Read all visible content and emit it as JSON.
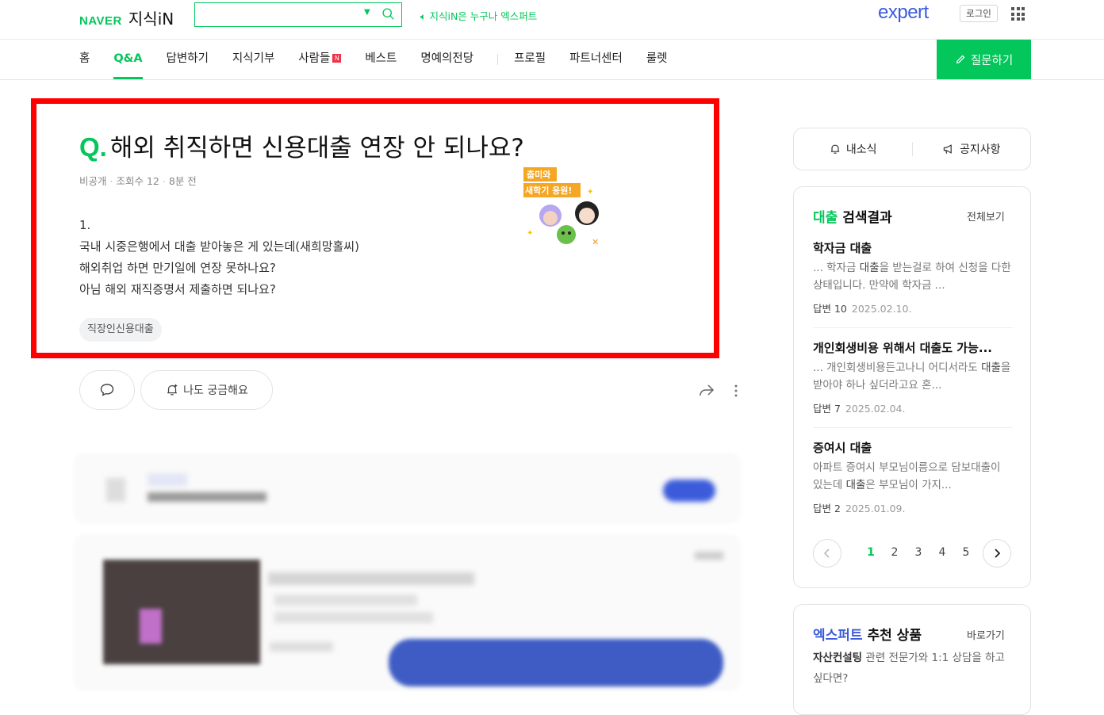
{
  "header": {
    "brand": "NAVER",
    "service": "지식iN",
    "search_value": "",
    "promo_text": "지식iN은 누구나 엑스퍼트",
    "expert_logo": "expert",
    "login_label": "로그인"
  },
  "nav": {
    "items": [
      {
        "label": "홈"
      },
      {
        "label": "Q&A"
      },
      {
        "label": "답변하기"
      },
      {
        "label": "지식기부"
      },
      {
        "label": "사람들"
      },
      {
        "label": "베스트"
      },
      {
        "label": "명예의전당"
      },
      {
        "label": "프로필"
      },
      {
        "label": "파트너센터"
      },
      {
        "label": "룰렛"
      }
    ],
    "new_badge": "N",
    "ask_label": "질문하기"
  },
  "question": {
    "prefix": "Q.",
    "title": "해외 취직하면 신용대출 연장 안 되나요?",
    "author": "비공개",
    "views": "조회수 12",
    "time": "8분 전",
    "body": [
      "1.",
      "국내 시중은행에서 대출 받아놓은 게 있는데(새희망홀씨)",
      "해외취업 하면 만기일에 연장 못하나요?",
      "아님 해외 재직증명서 제출하면 되나요?"
    ],
    "tag": "직장인신용대출",
    "sticker_line1": "춥미와",
    "sticker_line2": "새학기 응원!"
  },
  "actions": {
    "curious_label": "나도 궁금해요"
  },
  "side": {
    "news_label": "내소식",
    "notice_label": "공지사항",
    "result_keyword": "대출",
    "result_title": "검색결과",
    "result_all": "전체보기",
    "results": [
      {
        "title": "학자금 대출",
        "desc_pre": "... 학자금 ",
        "desc_hl": "대출",
        "desc_post": "을 받는걸로 하여 신청을 다한 상태입니다. 만약에 학자금 ...",
        "answers": "답변 10",
        "date": "2025.02.10."
      },
      {
        "title": "개인회생비용 위해서 대출도 가능...",
        "desc_pre": "... 개인회생비용든고나니 어디서라도 ",
        "desc_hl": "대출",
        "desc_post": "을 받아야 하나 싶더라고요 혼...",
        "answers": "답변 7",
        "date": "2025.02.04."
      },
      {
        "title": "증여시 대출",
        "desc_pre": "아파트 증여시 부모님이름으로 담보대출이 있는데 ",
        "desc_hl": "대출",
        "desc_post": "은 부모님이 가지...",
        "answers": "답변 2",
        "date": "2025.01.09."
      }
    ],
    "pages": [
      "1",
      "2",
      "3",
      "4",
      "5"
    ],
    "current_page": "1",
    "expert_keyword": "엑스퍼트",
    "expert_title": "추천 상품",
    "expert_go": "바로가기",
    "expert_desc_bold": "자산컨설팅",
    "expert_desc_rest": " 관련 전문가와 1:1 상담을 하고 싶다면?"
  },
  "colors": {
    "naver_green": "#03c75a",
    "expert_blue": "#3b5bdb",
    "highlight_red": "#ff0000",
    "new_badge": "#f0324b"
  }
}
